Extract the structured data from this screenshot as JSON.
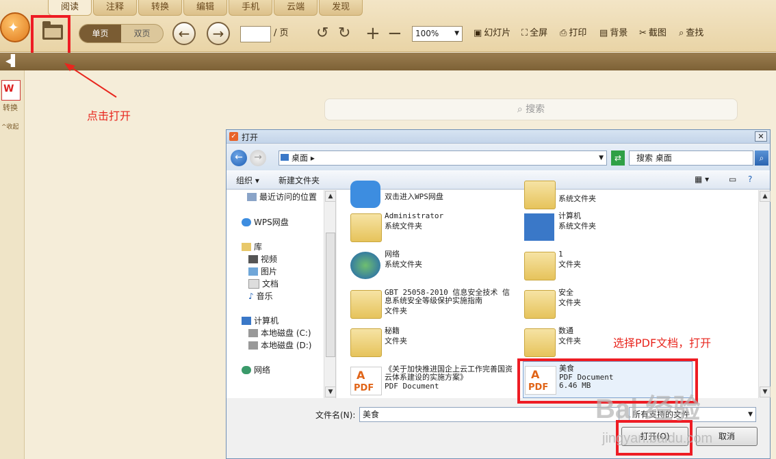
{
  "tabs": [
    "阅读",
    "注释",
    "转换",
    "编辑",
    "手机",
    "云端",
    "发现"
  ],
  "toolbar": {
    "single_page": "单页",
    "double_page": "双页",
    "page_suffix": "/ 页",
    "zoom": "100%",
    "slideshow": "幻灯片",
    "fullscreen": "全屏",
    "print": "打印",
    "background": "背景",
    "screenshot": "截图",
    "find": "查找"
  },
  "left": {
    "convert": "转换",
    "collapse": "^收起"
  },
  "main": {
    "search_placeholder": "搜索"
  },
  "annotations": {
    "click_open": "点击打开",
    "select_pdf": "选择PDF文档，打开"
  },
  "dialog": {
    "title": "打开",
    "address": "桌面",
    "search_placeholder": "搜索 桌面",
    "organize": "组织",
    "new_folder": "新建文件夹",
    "nav_items": [
      "最近访问的位置",
      "WPS网盘",
      "库",
      "视频",
      "图片",
      "文档",
      "音乐",
      "计算机",
      "本地磁盘 (C:)",
      "本地磁盘 (D:)",
      "网络"
    ],
    "files": [
      {
        "name": "双击进入WPS网盘",
        "type": ""
      },
      {
        "name": "",
        "type": "系统文件夹"
      },
      {
        "name": "Administrator",
        "type": "系统文件夹"
      },
      {
        "name": "计算机",
        "type": "系统文件夹"
      },
      {
        "name": "网络",
        "type": "系统文件夹"
      },
      {
        "name": "1",
        "type": "文件夹"
      },
      {
        "name": "GBT 25058-2010 信息安全技术 信息系统安全等级保护实施指南",
        "type": "文件夹"
      },
      {
        "name": "安全",
        "type": "文件夹"
      },
      {
        "name": "秘籍",
        "type": "文件夹"
      },
      {
        "name": "数通",
        "type": "文件夹"
      },
      {
        "name": "《关于加快推进国企上云工作完善国资云体系建设的实施方案》",
        "type": "PDF Document"
      },
      {
        "name": "美食",
        "type": "PDF Document",
        "size": "6.46 MB"
      }
    ],
    "filename_label": "文件名(N):",
    "filename_value": "美食",
    "filetype": "所有支持的文件",
    "open_button": "打开(O)",
    "cancel_button": "取消"
  },
  "watermark": {
    "main": "Bai 经验",
    "sub": "jingyan.baidu.com"
  },
  "colors": {
    "highlight": "#ee1c24",
    "brand": "#e07a1d"
  }
}
